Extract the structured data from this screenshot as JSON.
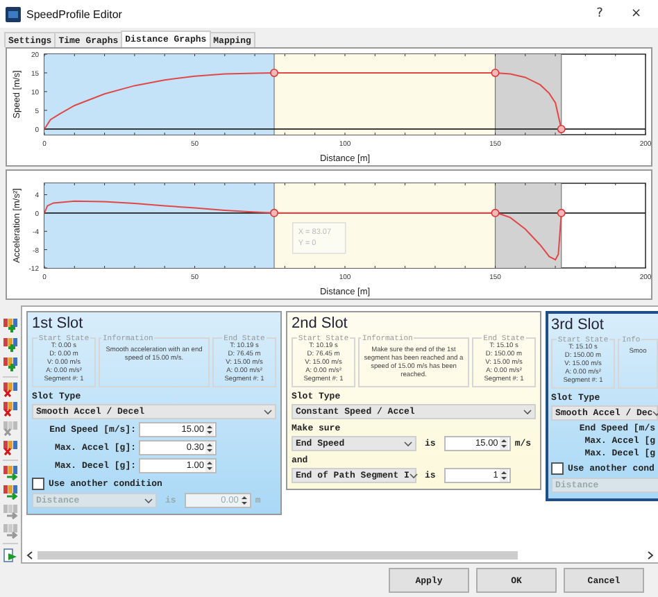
{
  "window": {
    "title": "SpeedProfile Editor",
    "help": "?",
    "close": "×"
  },
  "tabs": [
    {
      "label": "Settings",
      "selected": false
    },
    {
      "label": "Time Graphs",
      "selected": false
    },
    {
      "label": "Distance Graphs",
      "selected": true
    },
    {
      "label": "Mapping",
      "selected": false
    }
  ],
  "graphs": [
    {
      "chart_data": {
        "type": "line",
        "xlabel": "Distance [m]",
        "ylabel": "Speed [m/s]",
        "x": [
          0,
          2,
          5,
          10,
          20,
          30,
          40,
          50,
          60,
          70,
          76.45,
          100,
          150,
          155,
          160,
          165,
          168,
          170,
          172
        ],
        "series": [
          {
            "color": "#e04848",
            "values": [
              0,
              2.5,
              4,
              6.3,
              9.4,
              11.6,
              13.1,
              14.1,
              14.7,
              14.9,
              15,
              15,
              15,
              14.7,
              13.8,
              11.8,
              9.5,
              7,
              0
            ]
          }
        ],
        "xlim": [
          0,
          200
        ],
        "ylim": [
          -1.5,
          20
        ],
        "xticks": [
          0,
          50,
          100,
          150,
          200
        ],
        "yticks": [
          0,
          5,
          10,
          15,
          20
        ],
        "bands": [
          {
            "axis": "x",
            "from": 0,
            "to": 76.45,
            "color": "#c4e3f8"
          },
          {
            "axis": "x",
            "from": 76.45,
            "to": 150,
            "color": "#fdfbe7"
          },
          {
            "axis": "x",
            "from": 150,
            "to": 172,
            "color": "#d2d2d2"
          }
        ]
      }
    },
    {
      "chart_data": {
        "type": "line",
        "xlabel": "Distance [m]",
        "ylabel": "Acceleration [m/s²]",
        "x": [
          0,
          1,
          3,
          10,
          20,
          30,
          40,
          50,
          60,
          70,
          76.45,
          150,
          152,
          155,
          160,
          165,
          168,
          170,
          171,
          172
        ],
        "series": [
          {
            "color": "#e04848",
            "values": [
              0,
              1.6,
              2.2,
              2.6,
              2.5,
              2.1,
              1.6,
              1.1,
              0.6,
              0.2,
              0,
              0,
              -0.3,
              -1,
              -3.5,
              -7,
              -9.5,
              -10.2,
              -9,
              0
            ]
          }
        ],
        "xlim": [
          0,
          200
        ],
        "ylim": [
          -12,
          6.5
        ],
        "xticks": [
          0,
          50,
          100,
          150,
          200
        ],
        "yticks": [
          4,
          0,
          -4,
          -8,
          -12
        ],
        "bands": [
          {
            "axis": "x",
            "from": 0,
            "to": 76.45,
            "color": "#c4e3f8"
          },
          {
            "axis": "x",
            "from": 76.45,
            "to": 150,
            "color": "#fdfbe7"
          },
          {
            "axis": "x",
            "from": 150,
            "to": 172,
            "color": "#d2d2d2"
          }
        ],
        "annotations": [
          {
            "x": 83.07,
            "y": 0,
            "text": "X = 83.07\nY = 0"
          }
        ]
      }
    }
  ],
  "toolbar": [
    [
      {
        "kind": "add",
        "disabled": false
      },
      {
        "kind": "add",
        "disabled": false
      },
      {
        "kind": "add",
        "disabled": false
      }
    ],
    [
      {
        "kind": "remove",
        "disabled": false
      },
      {
        "kind": "remove",
        "disabled": false
      },
      {
        "kind": "remove",
        "disabled": true
      },
      {
        "kind": "remove",
        "disabled": false
      }
    ],
    [
      {
        "kind": "move",
        "disabled": false
      },
      {
        "kind": "move",
        "disabled": false
      },
      {
        "kind": "move",
        "disabled": true
      },
      {
        "kind": "move",
        "disabled": true
      }
    ],
    [
      {
        "kind": "export",
        "disabled": false
      }
    ]
  ],
  "slots": [
    {
      "title": "1st Slot",
      "selected": false,
      "color": "#a9d8f6",
      "start": {
        "title": "Start State",
        "lines": [
          "T: 0.00 s",
          "D: 0.00 m",
          "V: 0.00 m/s",
          "A: 0.00 m/s²",
          "Segment #: 1"
        ]
      },
      "info": {
        "title": "Information",
        "text": "Smooth acceleration with an end speed of 15.00 m/s."
      },
      "end": {
        "title": "End State",
        "lines": [
          "T: 10.19 s",
          "D: 76.45 m",
          "V: 15.00 m/s",
          "A: 0.00 m/s²",
          "Segment #: 1"
        ]
      },
      "slot_type_label": "Slot Type",
      "slot_type": "Smooth Accel / Decel",
      "controls": [
        {
          "kind": "param",
          "label": "End Speed [m/s]:",
          "value": "15.00"
        },
        {
          "kind": "param",
          "label": "Max. Accel [g]:",
          "value": "0.30"
        },
        {
          "kind": "param",
          "label": "Max. Decel [g]:",
          "value": "1.00"
        },
        {
          "kind": "checkbox",
          "label": "Use another condition",
          "checked": false
        },
        {
          "kind": "condition",
          "select": "Distance",
          "word": "is",
          "value": "0.00",
          "unit": "m",
          "disabled": true
        }
      ]
    },
    {
      "title": "2nd Slot",
      "selected": false,
      "color": "#fdf9dc",
      "start": {
        "title": "Start State",
        "lines": [
          "T: 10.19 s",
          "D: 76.45 m",
          "V: 15.00 m/s",
          "A: 0.00 m/s²",
          "Segment #: 1"
        ]
      },
      "info": {
        "title": "Information",
        "text": "Make sure the end of the 1st segment has been reached and a speed of 15.00 m/s has been reached."
      },
      "end": {
        "title": "End State",
        "lines": [
          "T: 15.10 s",
          "D: 150.00 m",
          "V: 15.00 m/s",
          "A: 0.00 m/s²",
          "Segment #: 1"
        ]
      },
      "slot_type_label": "Slot Type",
      "slot_type": "Constant Speed / Accel",
      "controls": [
        {
          "kind": "text",
          "text": "Make sure"
        },
        {
          "kind": "condition",
          "select": "End Speed",
          "word": "is",
          "value": "15.00",
          "unit": "m/s",
          "disabled": false
        },
        {
          "kind": "text",
          "text": "and"
        },
        {
          "kind": "condition",
          "select": "End of Path Segment I",
          "word": "is",
          "value": "1",
          "disabled": false
        }
      ]
    },
    {
      "title": "3rd Slot",
      "selected": true,
      "color": "#a9d8f6",
      "start": {
        "title": "Start State",
        "lines": [
          "T: 15.10 s",
          "D: 150.00 m",
          "V: 15.00 m/s",
          "A: 0.00 m/s²",
          "Segment #: 1"
        ]
      },
      "info": {
        "title": "Info",
        "text": "Smoo"
      },
      "slot_type_label": "Slot Type",
      "slot_type": "Smooth Accel / Dec",
      "controls": [
        {
          "kind": "param",
          "label": "End Speed [m/s"
        },
        {
          "kind": "param",
          "label": "Max. Accel [g"
        },
        {
          "kind": "param",
          "label": "Max. Decel [g"
        },
        {
          "kind": "checkbox",
          "label": "Use another cond",
          "checked": false
        },
        {
          "kind": "condition",
          "select": "Distance",
          "disabled": true
        }
      ]
    }
  ],
  "buttons": [
    "Apply",
    "OK",
    "Cancel"
  ]
}
